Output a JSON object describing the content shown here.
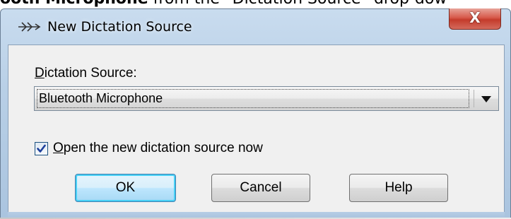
{
  "background_text": {
    "bold": "ooth Microphone",
    "rest": " from the “Dictation Source” drop-dow"
  },
  "dialog": {
    "title": "New Dictation Source",
    "title_icon": "dictation-source-icon",
    "close_glyph": "X",
    "field_label": {
      "mnemonic": "D",
      "rest": "ictation Source:"
    },
    "dictation_source": {
      "selected": "Bluetooth Microphone",
      "arrow_icon": "chevron-down-icon"
    },
    "open_now": {
      "checked": true,
      "mnemonic": "O",
      "rest": "pen the new dictation source now"
    },
    "buttons": {
      "ok": "OK",
      "cancel": "Cancel",
      "help": "Help"
    }
  },
  "colors": {
    "frame": "#b8cfe6",
    "client": "#f0f0f0",
    "close_button": "#d7594a",
    "default_button_glow": "#48d0f5",
    "checkmark": "#1d3f9b"
  }
}
